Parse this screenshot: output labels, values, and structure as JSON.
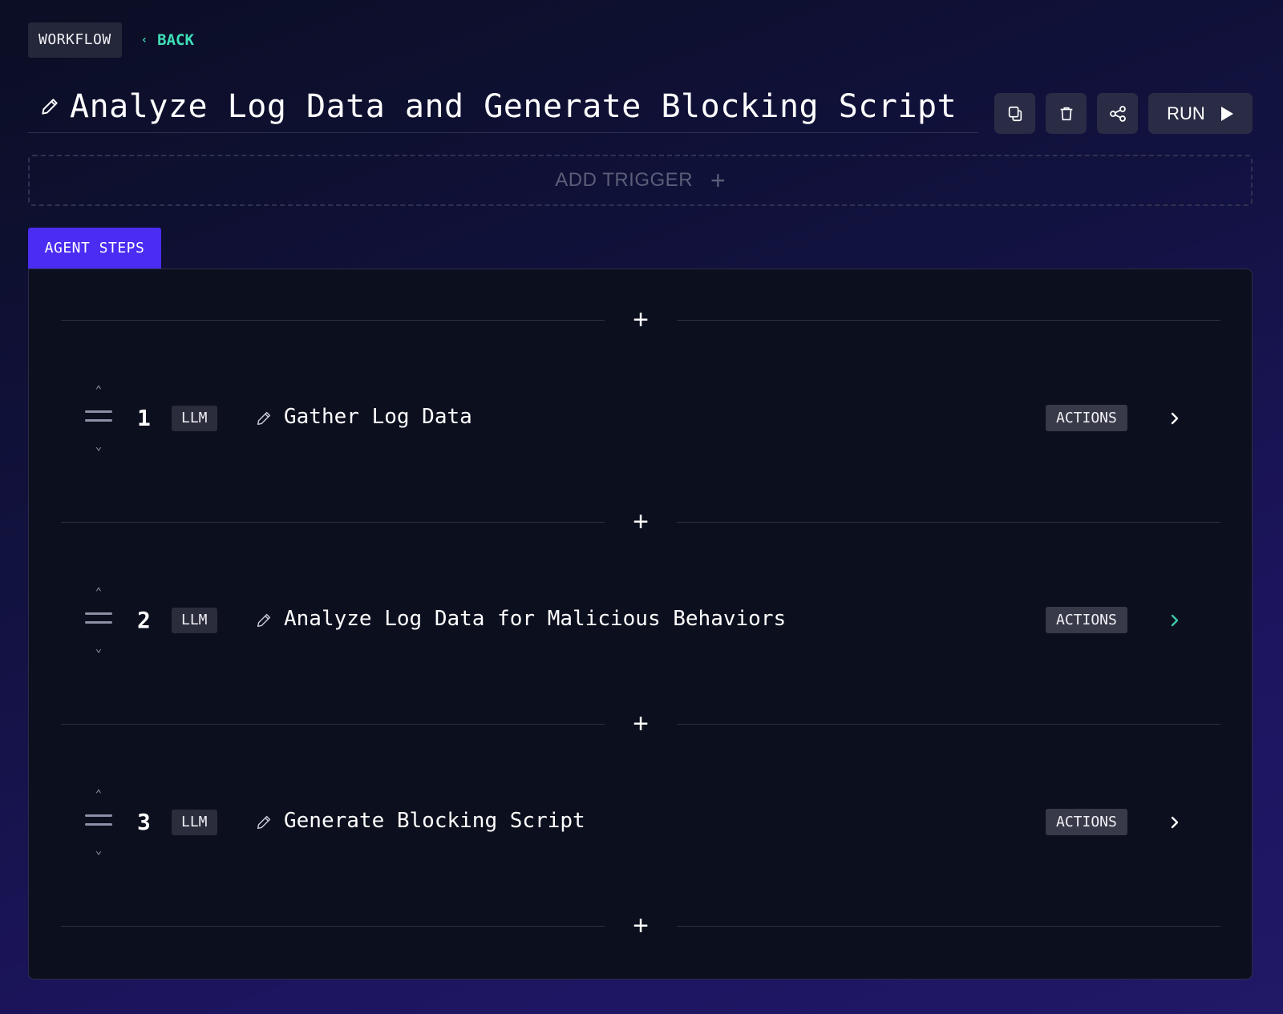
{
  "header": {
    "workflow_label": "WORKFLOW",
    "back_chevron": "‹",
    "back_label": "BACK",
    "title": "Analyze Log Data and Generate Blocking Script",
    "run_label": "RUN"
  },
  "toolbar_icons": [
    "duplicate-icon",
    "trash-icon",
    "share-icon",
    "play-icon"
  ],
  "trigger": {
    "label": "ADD TRIGGER",
    "plus": "+"
  },
  "tabs": {
    "agent_steps": "AGENT STEPS"
  },
  "add_step_glyph": "+",
  "reorder": {
    "up": "⌃",
    "down": "⌄"
  },
  "steps": [
    {
      "number": "1",
      "type": "LLM",
      "title": "Gather Log Data",
      "actions_label": "ACTIONS",
      "chevron_color": "#ffffff"
    },
    {
      "number": "2",
      "type": "LLM",
      "title": "Analyze Log Data for Malicious Behaviors",
      "actions_label": "ACTIONS",
      "chevron_color": "#3ec9a7"
    },
    {
      "number": "3",
      "type": "LLM",
      "title": "Generate Blocking Script",
      "actions_label": "ACTIONS",
      "chevron_color": "#ffffff"
    }
  ],
  "colors": {
    "accent": "#4b2cf2",
    "back_link": "#3ee0b8",
    "panel": "#0c0f1e"
  }
}
